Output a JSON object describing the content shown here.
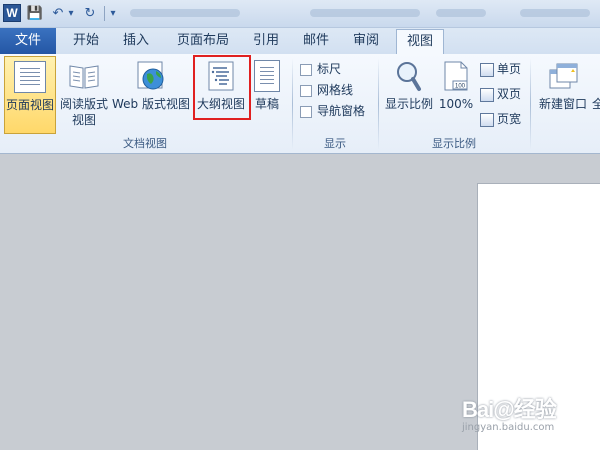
{
  "titlebar": {
    "app_icon_letter": "W",
    "qat_save": "💾",
    "qat_undo": "↶",
    "qat_dropdown": "▾",
    "qat_redo": "↻",
    "qat_customize": "▾"
  },
  "tabs": {
    "file": "文件",
    "items": [
      "开始",
      "插入",
      "页面布局",
      "引用",
      "邮件",
      "审阅",
      "视图"
    ],
    "active": "视图"
  },
  "ribbon": {
    "doc_views": {
      "label": "文档视图",
      "page_view": "页面视图",
      "reading_view": "阅读版式\n视图",
      "web_view": "Web 版式视图",
      "outline_view": "大纲视图",
      "draft": "草稿"
    },
    "show": {
      "label": "显示",
      "ruler": "标尺",
      "gridlines": "网格线",
      "nav_pane": "导航窗格"
    },
    "zoom": {
      "label": "显示比例",
      "zoom_btn": "显示比例",
      "hundred": "100%",
      "hundred_icon_text": "100",
      "one_page": "单页",
      "two_pages": "双页",
      "page_width": "页宽"
    },
    "window": {
      "new_window": "新建窗口",
      "truncated": "全"
    }
  },
  "watermark": {
    "main": "Bai@经验",
    "sub": "jingyan.baidu.com"
  }
}
